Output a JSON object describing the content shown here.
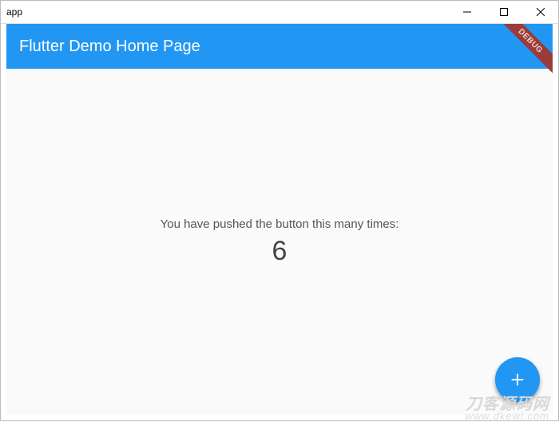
{
  "window": {
    "title": "app"
  },
  "appbar": {
    "title": "Flutter Demo Home Page"
  },
  "debug_banner": {
    "label": "DEBUG"
  },
  "body": {
    "message": "You have pushed the button this many times:",
    "count": "6"
  },
  "watermark": {
    "line1": "刀客源码网",
    "line2": "www.dkewl.com"
  }
}
